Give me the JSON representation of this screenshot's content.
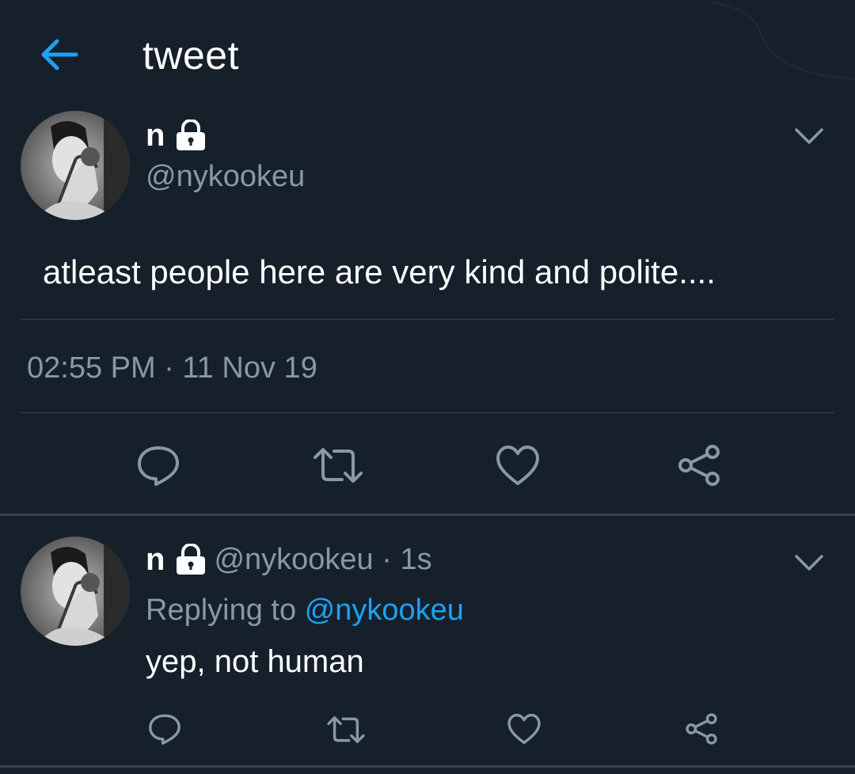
{
  "header": {
    "title": "tweet",
    "back_icon": "arrow-left-icon",
    "accent_color": "#1da1f2"
  },
  "main_tweet": {
    "display_name": "n",
    "protected_icon": "lock-icon",
    "handle": "@nykookeu",
    "text": "atleast people here are very kind and polite....",
    "timestamp": "02:55 PM · 11 Nov 19",
    "menu_icon": "chevron-down-icon",
    "actions": [
      "reply-icon",
      "retweet-icon",
      "like-icon",
      "share-icon"
    ]
  },
  "reply_tweet": {
    "display_name": "n",
    "protected_icon": "lock-icon",
    "handle_time": "@nykookeu · 1s",
    "replying_prefix": "Replying to ",
    "replying_handle": "@nykookeu",
    "text": "yep, not human",
    "menu_icon": "chevron-down-icon",
    "actions": [
      "reply-icon",
      "retweet-icon",
      "like-icon",
      "share-icon"
    ]
  },
  "colors": {
    "background": "#15202b",
    "secondary_text": "#8899a6",
    "divider": "#38444d",
    "link": "#1da1f2"
  }
}
